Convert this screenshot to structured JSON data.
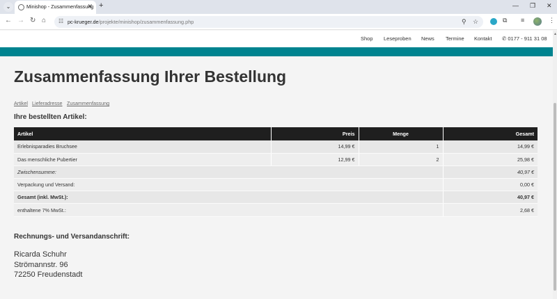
{
  "browser": {
    "tab_title": "Minishop - Zusammenfassung",
    "url_domain": "pc-krueger.de",
    "url_path": "/projekte/minishop/zusammenfassung.php"
  },
  "site_nav": {
    "items": [
      "Shop",
      "Leseproben",
      "News",
      "Termine",
      "Kontakt"
    ],
    "phone": "0177 - 911 31 08"
  },
  "page": {
    "title": "Zusammenfassung Ihrer Bestellung",
    "breadcrumb": [
      "Artikel",
      "Lieferadresse",
      "Zusammenfassung"
    ],
    "ordered_heading": "Ihre bestellten Artikel:",
    "address_heading": "Rechnungs- und Versandanschrift:"
  },
  "table": {
    "headers": [
      "Artikel",
      "Preis",
      "Menge",
      "Gesamt"
    ],
    "items": [
      {
        "name": "Erlebnisparadies Bruchsee",
        "price": "14,99 €",
        "qty": "1",
        "total": "14,99 €"
      },
      {
        "name": "Das menschliche Pubertier",
        "price": "12,99 €",
        "qty": "2",
        "total": "25,98 €"
      }
    ],
    "summary": [
      {
        "label": "Zwischensumme:",
        "value": "40,97 €",
        "style": "italic"
      },
      {
        "label": "Verpackung und Versand:",
        "value": "0,00 €",
        "style": "normal"
      },
      {
        "label": "Gesamt (inkl. MwSt.):",
        "value": "40,97 €",
        "style": "bold"
      },
      {
        "label": "enthaltene 7% MwSt.:",
        "value": "2,68 €",
        "style": "normal"
      }
    ]
  },
  "address": {
    "name": "Ricarda Schuhr",
    "street": "Strömannstr. 96",
    "city": "72250 Freudenstadt"
  },
  "colors": {
    "accent_bar": "#00838f",
    "table_header_bg": "#1f1f1f"
  }
}
